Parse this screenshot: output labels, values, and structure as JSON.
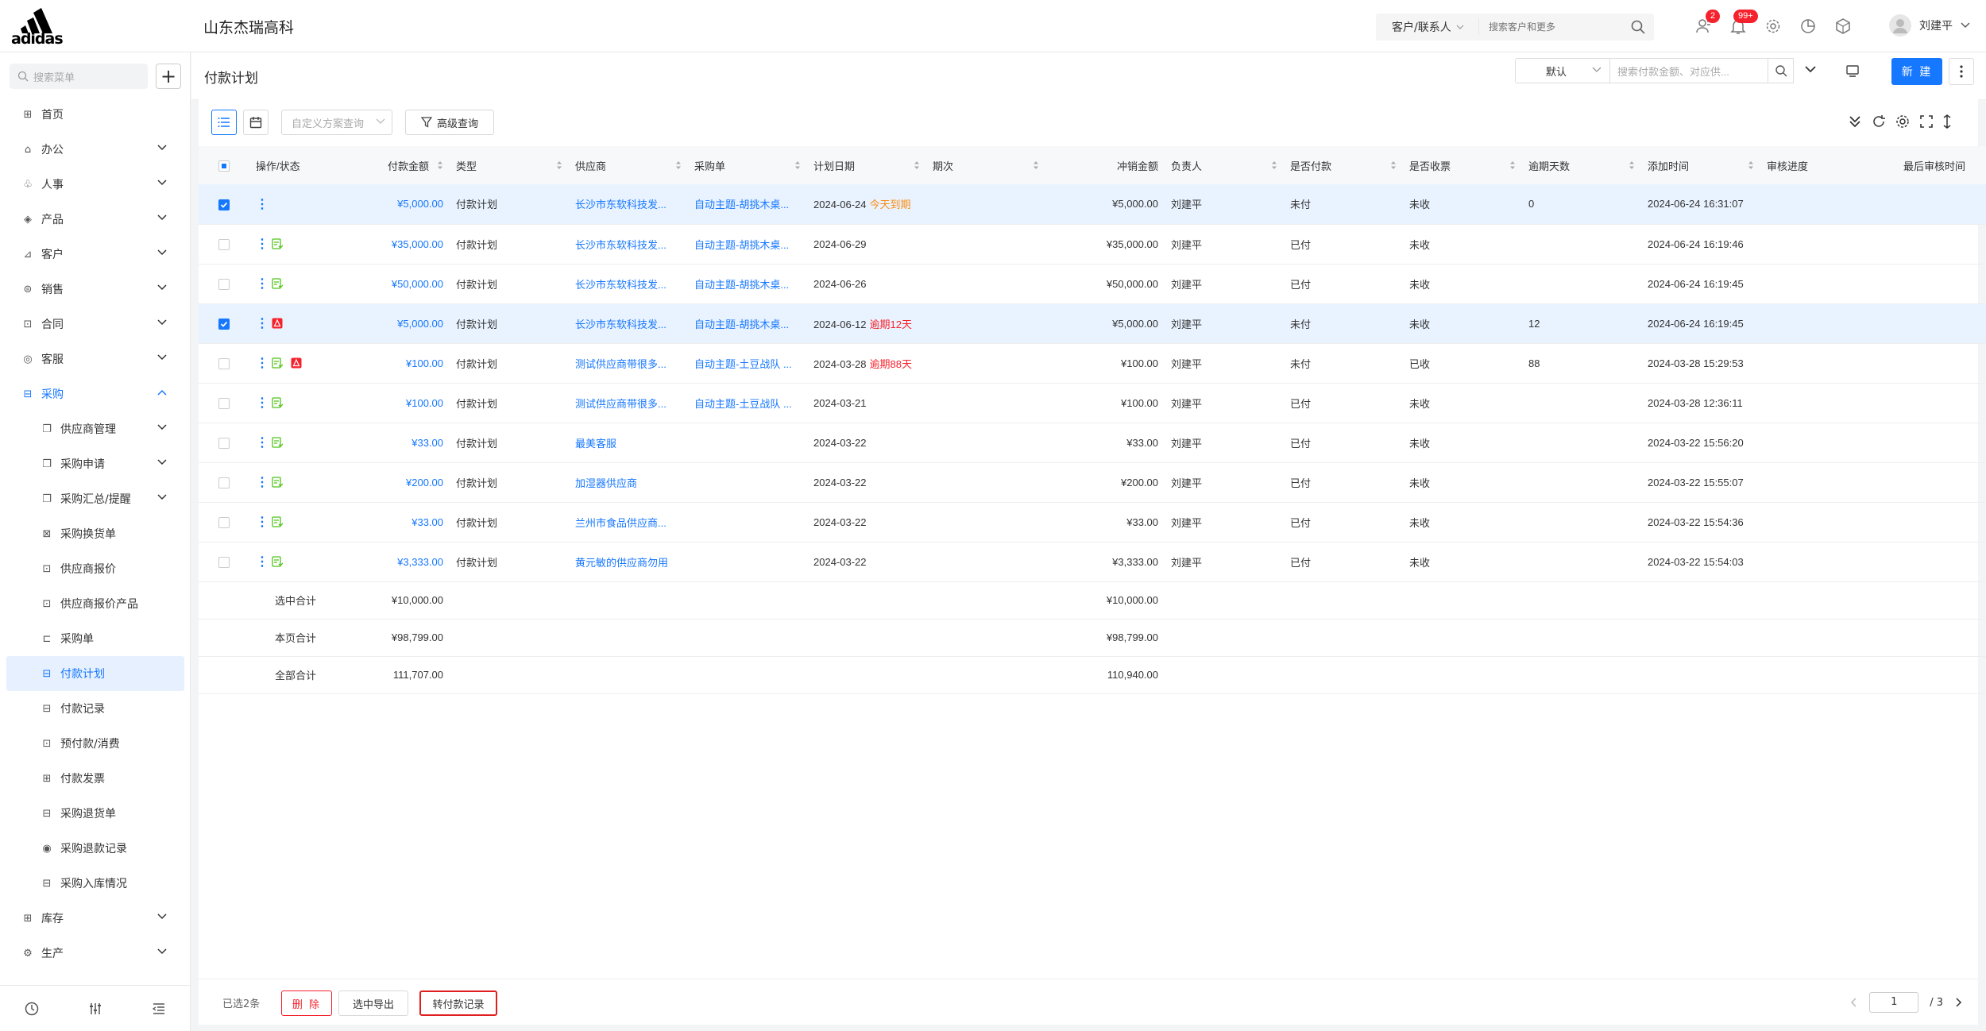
{
  "app": {
    "logo_text": "adidas",
    "company": "山东杰瑞高科"
  },
  "topbar": {
    "search_scope": "客户/联系人",
    "search_placeholder": "搜索客户和更多",
    "badge_users": "2",
    "badge_bell": "99+",
    "user_name": "刘建平"
  },
  "sidebar": {
    "search_placeholder": "搜索菜单",
    "items": [
      {
        "label": "首页",
        "icon": "home-icon"
      },
      {
        "label": "办公",
        "icon": "office-icon"
      },
      {
        "label": "人事",
        "icon": "hr-icon"
      },
      {
        "label": "产品",
        "icon": "product-icon"
      },
      {
        "label": "客户",
        "icon": "customer-icon"
      },
      {
        "label": "销售",
        "icon": "sales-icon"
      },
      {
        "label": "合同",
        "icon": "contract-icon"
      },
      {
        "label": "客服",
        "icon": "service-icon"
      },
      {
        "label": "采购",
        "icon": "purchase-icon"
      }
    ],
    "sub_items": [
      "供应商管理",
      "采购申请",
      "采购汇总/提醒",
      "采购换货单",
      "供应商报价",
      "供应商报价产品",
      "采购单",
      "付款计划",
      "付款记录",
      "预付款/消费",
      "付款发票",
      "采购退货单",
      "采购退款记录",
      "采购入库情况"
    ],
    "after_items": [
      {
        "label": "库存",
        "icon": "inventory-icon"
      },
      {
        "label": "生产",
        "icon": "production-icon"
      }
    ]
  },
  "header": {
    "title": "付款计划",
    "view_select": "默认",
    "search_placeholder": "搜索付款金额、对应供...",
    "new_label": "新 建"
  },
  "toolbar": {
    "custom_query": "自定义方案查询",
    "advanced_query": "高级查询"
  },
  "table": {
    "columns": [
      "操作/状态",
      "付款金额",
      "类型",
      "供应商",
      "采购单",
      "计划日期",
      "期次",
      "冲销金额",
      "负责人",
      "是否付款",
      "是否收票",
      "逾期天数",
      "添加时间",
      "审核进度",
      "最后审核时间"
    ],
    "rows": [
      {
        "checked": true,
        "amount": "¥5,000.00",
        "type": "付款计划",
        "supplier": "长沙市东软科技发...",
        "order": "自动主题-胡挑木桌...",
        "date": "2024-06-24",
        "date_note": "今天到期",
        "note_kind": "warn",
        "offset": "¥5,000.00",
        "owner": "刘建平",
        "paid": "未付",
        "invoice": "未收",
        "overdue": "0",
        "added": "2024-06-24 16:31:07",
        "icons": []
      },
      {
        "checked": false,
        "amount": "¥35,000.00",
        "type": "付款计划",
        "supplier": "长沙市东软科技发...",
        "order": "自动主题-胡挑木桌...",
        "date": "2024-06-29",
        "date_note": "",
        "note_kind": "",
        "offset": "¥35,000.00",
        "owner": "刘建平",
        "paid": "已付",
        "invoice": "未收",
        "overdue": "",
        "added": "2024-06-24 16:19:46",
        "icons": [
          "green"
        ]
      },
      {
        "checked": false,
        "amount": "¥50,000.00",
        "type": "付款计划",
        "supplier": "长沙市东软科技发...",
        "order": "自动主题-胡挑木桌...",
        "date": "2024-06-26",
        "date_note": "",
        "note_kind": "",
        "offset": "¥50,000.00",
        "owner": "刘建平",
        "paid": "已付",
        "invoice": "未收",
        "overdue": "",
        "added": "2024-06-24 16:19:45",
        "icons": [
          "green"
        ]
      },
      {
        "checked": true,
        "amount": "¥5,000.00",
        "type": "付款计划",
        "supplier": "长沙市东软科技发...",
        "order": "自动主题-胡挑木桌...",
        "date": "2024-06-12",
        "date_note": "逾期12天",
        "note_kind": "danger",
        "offset": "¥5,000.00",
        "owner": "刘建平",
        "paid": "未付",
        "invoice": "未收",
        "overdue": "12",
        "added": "2024-06-24 16:19:45",
        "icons": [
          "red"
        ]
      },
      {
        "checked": false,
        "amount": "¥100.00",
        "type": "付款计划",
        "supplier": "测试供应商带很多...",
        "order": "自动主题-土豆战队 ...",
        "date": "2024-03-28",
        "date_note": "逾期88天",
        "note_kind": "danger",
        "offset": "¥100.00",
        "owner": "刘建平",
        "paid": "未付",
        "invoice": "已收",
        "overdue": "88",
        "added": "2024-03-28 15:29:53",
        "icons": [
          "green",
          "red"
        ]
      },
      {
        "checked": false,
        "amount": "¥100.00",
        "type": "付款计划",
        "supplier": "测试供应商带很多...",
        "order": "自动主题-土豆战队 ...",
        "date": "2024-03-21",
        "date_note": "",
        "note_kind": "",
        "offset": "¥100.00",
        "owner": "刘建平",
        "paid": "已付",
        "invoice": "未收",
        "overdue": "",
        "added": "2024-03-28 12:36:11",
        "icons": [
          "green"
        ]
      },
      {
        "checked": false,
        "amount": "¥33.00",
        "type": "付款计划",
        "supplier": "最美客服",
        "order": "",
        "date": "2024-03-22",
        "date_note": "",
        "note_kind": "",
        "offset": "¥33.00",
        "owner": "刘建平",
        "paid": "已付",
        "invoice": "未收",
        "overdue": "",
        "added": "2024-03-22 15:56:20",
        "icons": [
          "green"
        ]
      },
      {
        "checked": false,
        "amount": "¥200.00",
        "type": "付款计划",
        "supplier": "加湿器供应商",
        "order": "",
        "date": "2024-03-22",
        "date_note": "",
        "note_kind": "",
        "offset": "¥200.00",
        "owner": "刘建平",
        "paid": "已付",
        "invoice": "未收",
        "overdue": "",
        "added": "2024-03-22 15:55:07",
        "icons": [
          "green"
        ]
      },
      {
        "checked": false,
        "amount": "¥33.00",
        "type": "付款计划",
        "supplier": "兰州市食品供应商...",
        "order": "",
        "date": "2024-03-22",
        "date_note": "",
        "note_kind": "",
        "offset": "¥33.00",
        "owner": "刘建平",
        "paid": "已付",
        "invoice": "未收",
        "overdue": "",
        "added": "2024-03-22 15:54:36",
        "icons": [
          "green"
        ]
      },
      {
        "checked": false,
        "amount": "¥3,333.00",
        "type": "付款计划",
        "supplier": "黄元敏的供应商勿用",
        "order": "",
        "date": "2024-03-22",
        "date_note": "",
        "note_kind": "",
        "offset": "¥3,333.00",
        "owner": "刘建平",
        "paid": "已付",
        "invoice": "未收",
        "overdue": "",
        "added": "2024-03-22 15:54:03",
        "icons": [
          "green"
        ]
      }
    ],
    "summary": [
      {
        "label": "选中合计",
        "amount": "¥10,000.00",
        "offset": "¥10,000.00"
      },
      {
        "label": "本页合计",
        "amount": "¥98,799.00",
        "offset": "¥98,799.00"
      },
      {
        "label": "全部合计",
        "amount": "111,707.00",
        "offset": "110,940.00"
      }
    ]
  },
  "footer": {
    "selected_count": "已选2条",
    "delete_label": "删 除",
    "export_label": "选中导出",
    "convert_label": "转付款记录",
    "current_page": "1",
    "total_pages": "/ 3"
  },
  "colors": {
    "accent": "#1677ff",
    "danger": "#f5222d",
    "warn": "#fa8c16",
    "success": "#52c41a"
  }
}
